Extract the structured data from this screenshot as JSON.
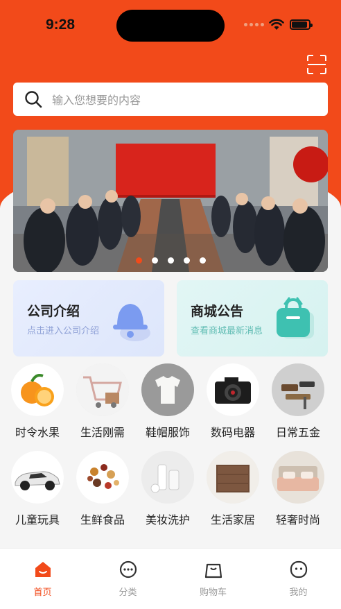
{
  "status_bar": {
    "time": "9:28"
  },
  "search": {
    "placeholder": "输入您想要的内容"
  },
  "banner": {
    "slide_count": 5,
    "active_index": 0
  },
  "cards": [
    {
      "title": "公司介绍",
      "subtitle": "点击进入公司介绍"
    },
    {
      "title": "商城公告",
      "subtitle": "查看商城最新消息"
    }
  ],
  "categories": [
    {
      "label": "时令水果",
      "icon": "fruit-icon"
    },
    {
      "label": "生活刚需",
      "icon": "shopping-cart-icon"
    },
    {
      "label": "鞋帽服饰",
      "icon": "clothing-icon"
    },
    {
      "label": "数码电器",
      "icon": "camera-icon"
    },
    {
      "label": "日常五金",
      "icon": "hardware-tools-icon"
    },
    {
      "label": "儿童玩具",
      "icon": "toy-car-icon"
    },
    {
      "label": "生鲜食品",
      "icon": "nuts-food-icon"
    },
    {
      "label": "美妆洗护",
      "icon": "cosmetics-icon"
    },
    {
      "label": "生活家居",
      "icon": "cabinet-icon"
    },
    {
      "label": "轻奢时尚",
      "icon": "bed-icon"
    }
  ],
  "tabs": [
    {
      "label": "首页",
      "icon": "home-icon",
      "active": true
    },
    {
      "label": "分类",
      "icon": "category-icon",
      "active": false
    },
    {
      "label": "购物车",
      "icon": "shopping-bag-icon",
      "active": false
    },
    {
      "label": "我的",
      "icon": "profile-icon",
      "active": false
    }
  ],
  "colors": {
    "brand": "#f24a1a",
    "background": "#f5f5f5"
  }
}
